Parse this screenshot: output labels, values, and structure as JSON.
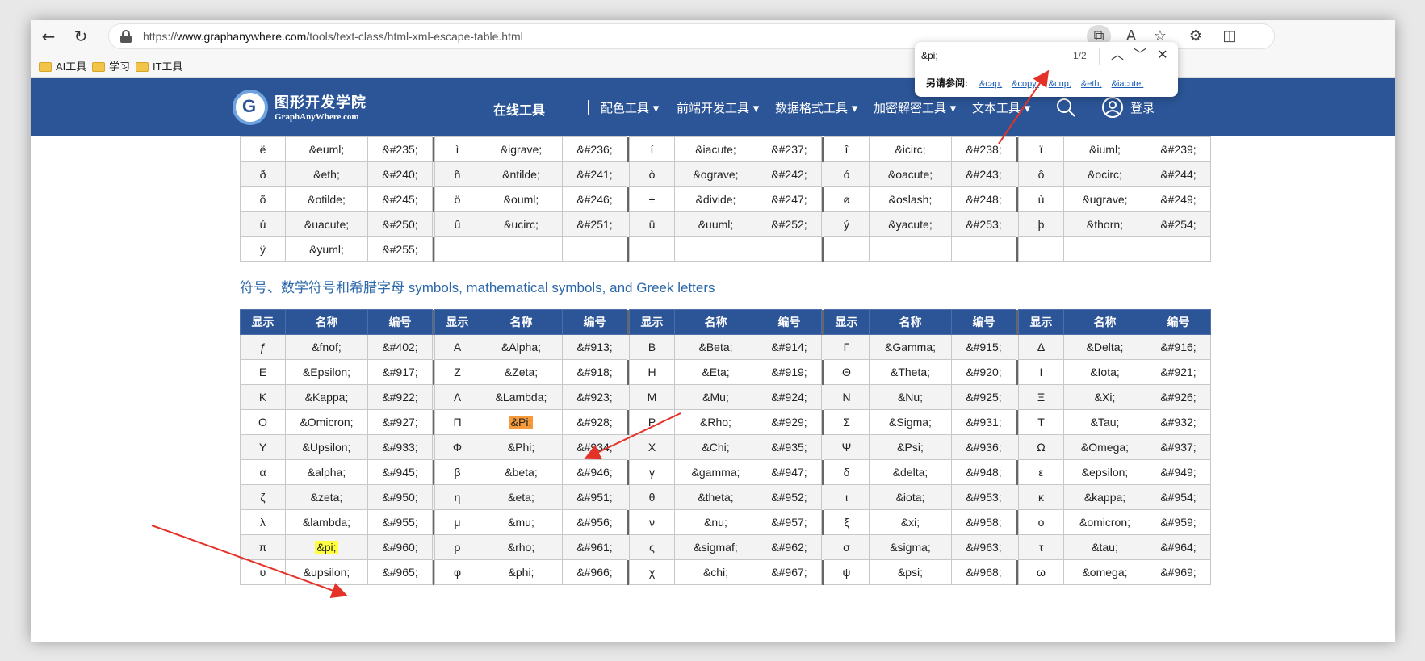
{
  "browser": {
    "url_prefix": "https://",
    "url_host": "www.graphanywhere.com",
    "url_path": "/tools/text-class/html-xml-escape-table.html",
    "bookmarks": [
      "AI工具",
      "学习",
      "IT工具"
    ]
  },
  "site": {
    "logo_cn": "图形开发学院",
    "logo_en": "GraphAnyWhere.com",
    "nav": [
      "在线工具",
      "配色工具",
      "前端开发工具",
      "数据格式工具",
      "加密解密工具",
      "文本工具",
      "登录"
    ]
  },
  "find": {
    "query": "&pi;",
    "count": "1/2",
    "also_label": "另请参阅:",
    "also_links": [
      "&cap;",
      "&copy;",
      "&cup;",
      "&eth;",
      "&iacute;"
    ]
  },
  "section_title": "符号、数学符号和希腊字母 symbols, mathematical symbols, and Greek letters",
  "headers": [
    "显示",
    "名称",
    "编号"
  ],
  "top_rows": [
    [
      [
        "ë",
        "&euml;",
        "&#235;"
      ],
      [
        "ì",
        "&igrave;",
        "&#236;"
      ],
      [
        "í",
        "&iacute;",
        "&#237;"
      ],
      [
        "î",
        "&icirc;",
        "&#238;"
      ],
      [
        "ï",
        "&iuml;",
        "&#239;"
      ]
    ],
    [
      [
        "ð",
        "&eth;",
        "&#240;"
      ],
      [
        "ñ",
        "&ntilde;",
        "&#241;"
      ],
      [
        "ò",
        "&ograve;",
        "&#242;"
      ],
      [
        "ó",
        "&oacute;",
        "&#243;"
      ],
      [
        "ô",
        "&ocirc;",
        "&#244;"
      ]
    ],
    [
      [
        "õ",
        "&otilde;",
        "&#245;"
      ],
      [
        "ö",
        "&ouml;",
        "&#246;"
      ],
      [
        "÷",
        "&divide;",
        "&#247;"
      ],
      [
        "ø",
        "&oslash;",
        "&#248;"
      ],
      [
        "ù",
        "&ugrave;",
        "&#249;"
      ]
    ],
    [
      [
        "ú",
        "&uacute;",
        "&#250;"
      ],
      [
        "û",
        "&ucirc;",
        "&#251;"
      ],
      [
        "ü",
        "&uuml;",
        "&#252;"
      ],
      [
        "ý",
        "&yacute;",
        "&#253;"
      ],
      [
        "þ",
        "&thorn;",
        "&#254;"
      ]
    ],
    [
      [
        "ÿ",
        "&yuml;",
        "&#255;"
      ],
      [
        "",
        "",
        ""
      ],
      [
        "",
        "",
        ""
      ],
      [
        "",
        "",
        ""
      ],
      [
        "",
        "",
        ""
      ]
    ]
  ],
  "greek_rows": [
    [
      [
        "ƒ",
        "&fnof;",
        "&#402;"
      ],
      [
        "Α",
        "&Alpha;",
        "&#913;"
      ],
      [
        "Β",
        "&Beta;",
        "&#914;"
      ],
      [
        "Γ",
        "&Gamma;",
        "&#915;"
      ],
      [
        "Δ",
        "&Delta;",
        "&#916;"
      ]
    ],
    [
      [
        "Ε",
        "&Epsilon;",
        "&#917;"
      ],
      [
        "Ζ",
        "&Zeta;",
        "&#918;"
      ],
      [
        "Η",
        "&Eta;",
        "&#919;"
      ],
      [
        "Θ",
        "&Theta;",
        "&#920;"
      ],
      [
        "Ι",
        "&Iota;",
        "&#921;"
      ]
    ],
    [
      [
        "Κ",
        "&Kappa;",
        "&#922;"
      ],
      [
        "Λ",
        "&Lambda;",
        "&#923;"
      ],
      [
        "Μ",
        "&Mu;",
        "&#924;"
      ],
      [
        "Ν",
        "&Nu;",
        "&#925;"
      ],
      [
        "Ξ",
        "&Xi;",
        "&#926;"
      ]
    ],
    [
      [
        "Ο",
        "&Omicron;",
        "&#927;"
      ],
      [
        "Π",
        "&Pi;",
        "&#928;"
      ],
      [
        "Ρ",
        "&Rho;",
        "&#929;"
      ],
      [
        "Σ",
        "&Sigma;",
        "&#931;"
      ],
      [
        "Τ",
        "&Tau;",
        "&#932;"
      ]
    ],
    [
      [
        "Υ",
        "&Upsilon;",
        "&#933;"
      ],
      [
        "Φ",
        "&Phi;",
        "&#934;"
      ],
      [
        "Χ",
        "&Chi;",
        "&#935;"
      ],
      [
        "Ψ",
        "&Psi;",
        "&#936;"
      ],
      [
        "Ω",
        "&Omega;",
        "&#937;"
      ]
    ],
    [
      [
        "α",
        "&alpha;",
        "&#945;"
      ],
      [
        "β",
        "&beta;",
        "&#946;"
      ],
      [
        "γ",
        "&gamma;",
        "&#947;"
      ],
      [
        "δ",
        "&delta;",
        "&#948;"
      ],
      [
        "ε",
        "&epsilon;",
        "&#949;"
      ]
    ],
    [
      [
        "ζ",
        "&zeta;",
        "&#950;"
      ],
      [
        "η",
        "&eta;",
        "&#951;"
      ],
      [
        "θ",
        "&theta;",
        "&#952;"
      ],
      [
        "ι",
        "&iota;",
        "&#953;"
      ],
      [
        "κ",
        "&kappa;",
        "&#954;"
      ]
    ],
    [
      [
        "λ",
        "&lambda;",
        "&#955;"
      ],
      [
        "μ",
        "&mu;",
        "&#956;"
      ],
      [
        "ν",
        "&nu;",
        "&#957;"
      ],
      [
        "ξ",
        "&xi;",
        "&#958;"
      ],
      [
        "ο",
        "&omicron;",
        "&#959;"
      ]
    ],
    [
      [
        "π",
        "&pi;",
        "&#960;"
      ],
      [
        "ρ",
        "&rho;",
        "&#961;"
      ],
      [
        "ς",
        "&sigmaf;",
        "&#962;"
      ],
      [
        "σ",
        "&sigma;",
        "&#963;"
      ],
      [
        "τ",
        "&tau;",
        "&#964;"
      ]
    ],
    [
      [
        "υ",
        "&upsilon;",
        "&#965;"
      ],
      [
        "φ",
        "&phi;",
        "&#966;"
      ],
      [
        "χ",
        "&chi;",
        "&#967;"
      ],
      [
        "ψ",
        "&psi;",
        "&#968;"
      ],
      [
        "ω",
        "&omega;",
        "&#969;"
      ]
    ]
  ],
  "highlights": {
    "current_match": "&pi;",
    "other_match": "&Pi;"
  },
  "colors": {
    "header_blue": "#2b5597",
    "current_highlight": "#ffff3d",
    "other_highlight": "#f79a3b",
    "arrow_red": "#e53228"
  }
}
